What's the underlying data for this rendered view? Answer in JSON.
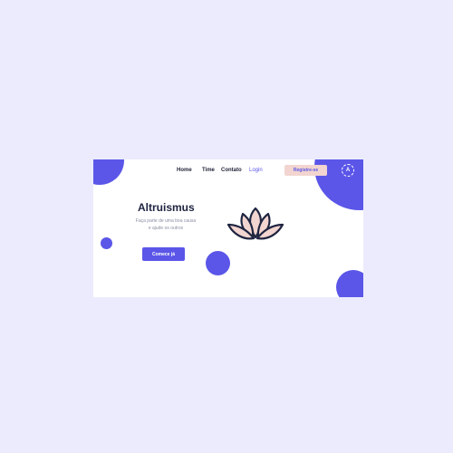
{
  "nav": {
    "home": "Home",
    "time": "Time",
    "contato": "Contato",
    "login": "Login",
    "register": "Registre-se",
    "lang": "A"
  },
  "hero": {
    "title": "Altruismus",
    "subtitle_line1": "Faça parte de uma boa causa",
    "subtitle_line2": "e ajude os outros",
    "cta": "Comece já"
  },
  "icons": {
    "logo": "lotus-icon",
    "language": "language-badge-icon"
  },
  "colors": {
    "accent": "#5b56e8",
    "button_pink": "#f2d5d0",
    "title": "#1f2440",
    "background": "#ecebfd"
  }
}
